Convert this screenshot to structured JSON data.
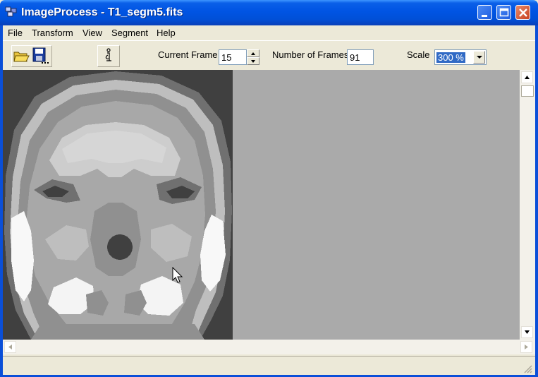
{
  "window": {
    "title": "ImageProcess - T1_segm5.fits"
  },
  "menu": {
    "items": [
      "File",
      "Transform",
      "View",
      "Segment",
      "Help"
    ]
  },
  "toolbar": {
    "current_frame_label": "Current Frame",
    "current_frame_value": "15",
    "num_frames_label": "Number of Frames",
    "num_frames_value": "91",
    "scale_label": "Scale",
    "scale_value": "300 %"
  },
  "icons": [
    "app-icon",
    "open-folder-icon",
    "save-disk-icon",
    "info-icon",
    "minimize-icon",
    "maximize-icon",
    "close-icon",
    "scroll-up-icon",
    "scroll-down-icon",
    "scroll-left-icon",
    "scroll-right-icon",
    "size-grip-icon"
  ],
  "colors": {
    "titlebar": "#0054e3",
    "canvas_bg": "#aaaaaa",
    "image_bg": "#404040",
    "selection": "#316ac5"
  }
}
